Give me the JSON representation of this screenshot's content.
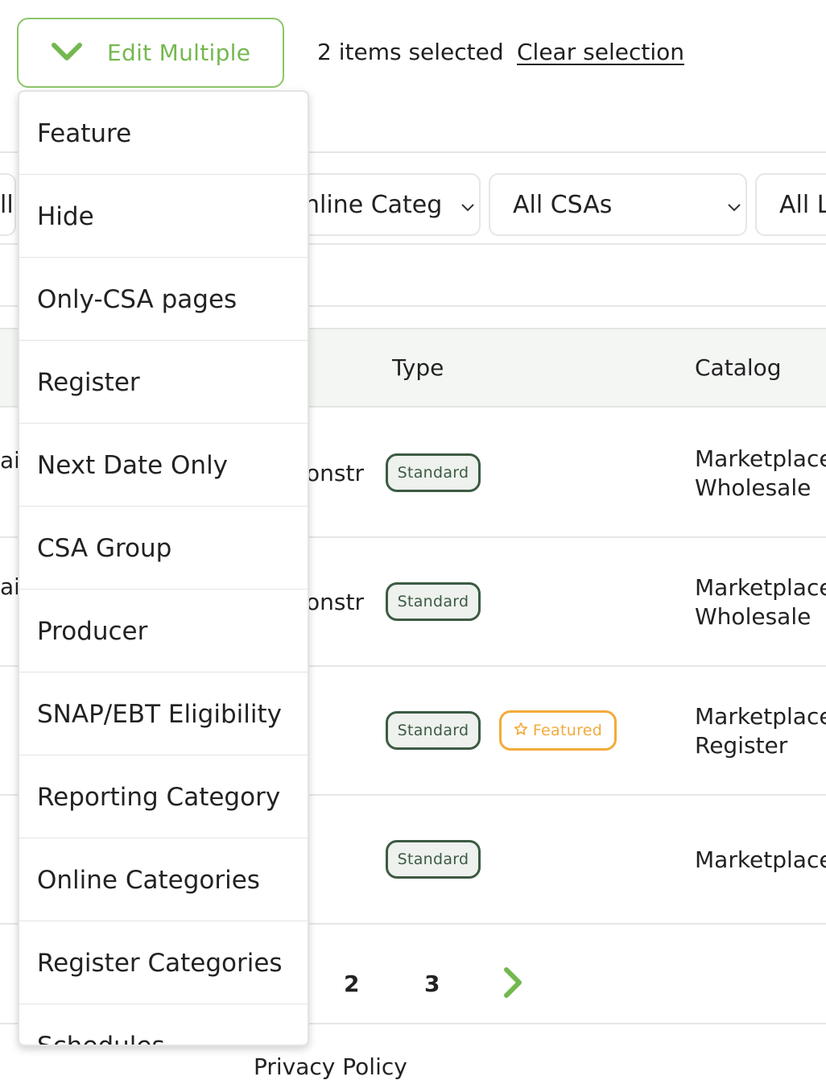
{
  "toolbar": {
    "edit_multiple_label": "Edit Multiple",
    "selected_count": "2 items selected",
    "clear_selection": "Clear selection",
    "accent_color": "#74b84f"
  },
  "filters": {
    "partial_left": "ll",
    "online_categories": "nline Categ",
    "csas": "All CSAs",
    "partial_right": "All L"
  },
  "table": {
    "headers": {
      "type": "Type",
      "catalog": "Catalog"
    },
    "rows": [
      {
        "name_fragment": "ai",
        "col2_fragment": "onstr",
        "badges": [
          "Standard"
        ],
        "catalog_line1": "Marketplace",
        "catalog_line2": "Wholesale"
      },
      {
        "name_fragment": "ai",
        "col2_fragment": "onstr",
        "badges": [
          "Standard"
        ],
        "catalog_line1": "Marketplace",
        "catalog_line2": "Wholesale"
      },
      {
        "name_fragment": "",
        "col2_fragment": "",
        "badges": [
          "Standard",
          "Featured"
        ],
        "catalog_line1": "Marketplace",
        "catalog_line2": "Register"
      },
      {
        "name_fragment": "",
        "col2_fragment": "",
        "badges": [
          "Standard"
        ],
        "catalog_line1": "Marketplace",
        "catalog_line2": ""
      }
    ],
    "badge_colors": {
      "standard": "#3c5b43",
      "featured": "#f2ab3b"
    }
  },
  "pagination": {
    "page2": "2",
    "page3": "3",
    "next_icon": "chevron-right-icon"
  },
  "footer_fragment": "Privacy Policy",
  "menu": {
    "items": [
      "Feature",
      "Hide",
      "Only-CSA pages",
      "Register",
      "Next Date Only",
      "CSA Group",
      "Producer",
      "SNAP/EBT Eligibility",
      "Reporting Category",
      "Online Categories",
      "Register Categories",
      "Schedules"
    ]
  }
}
